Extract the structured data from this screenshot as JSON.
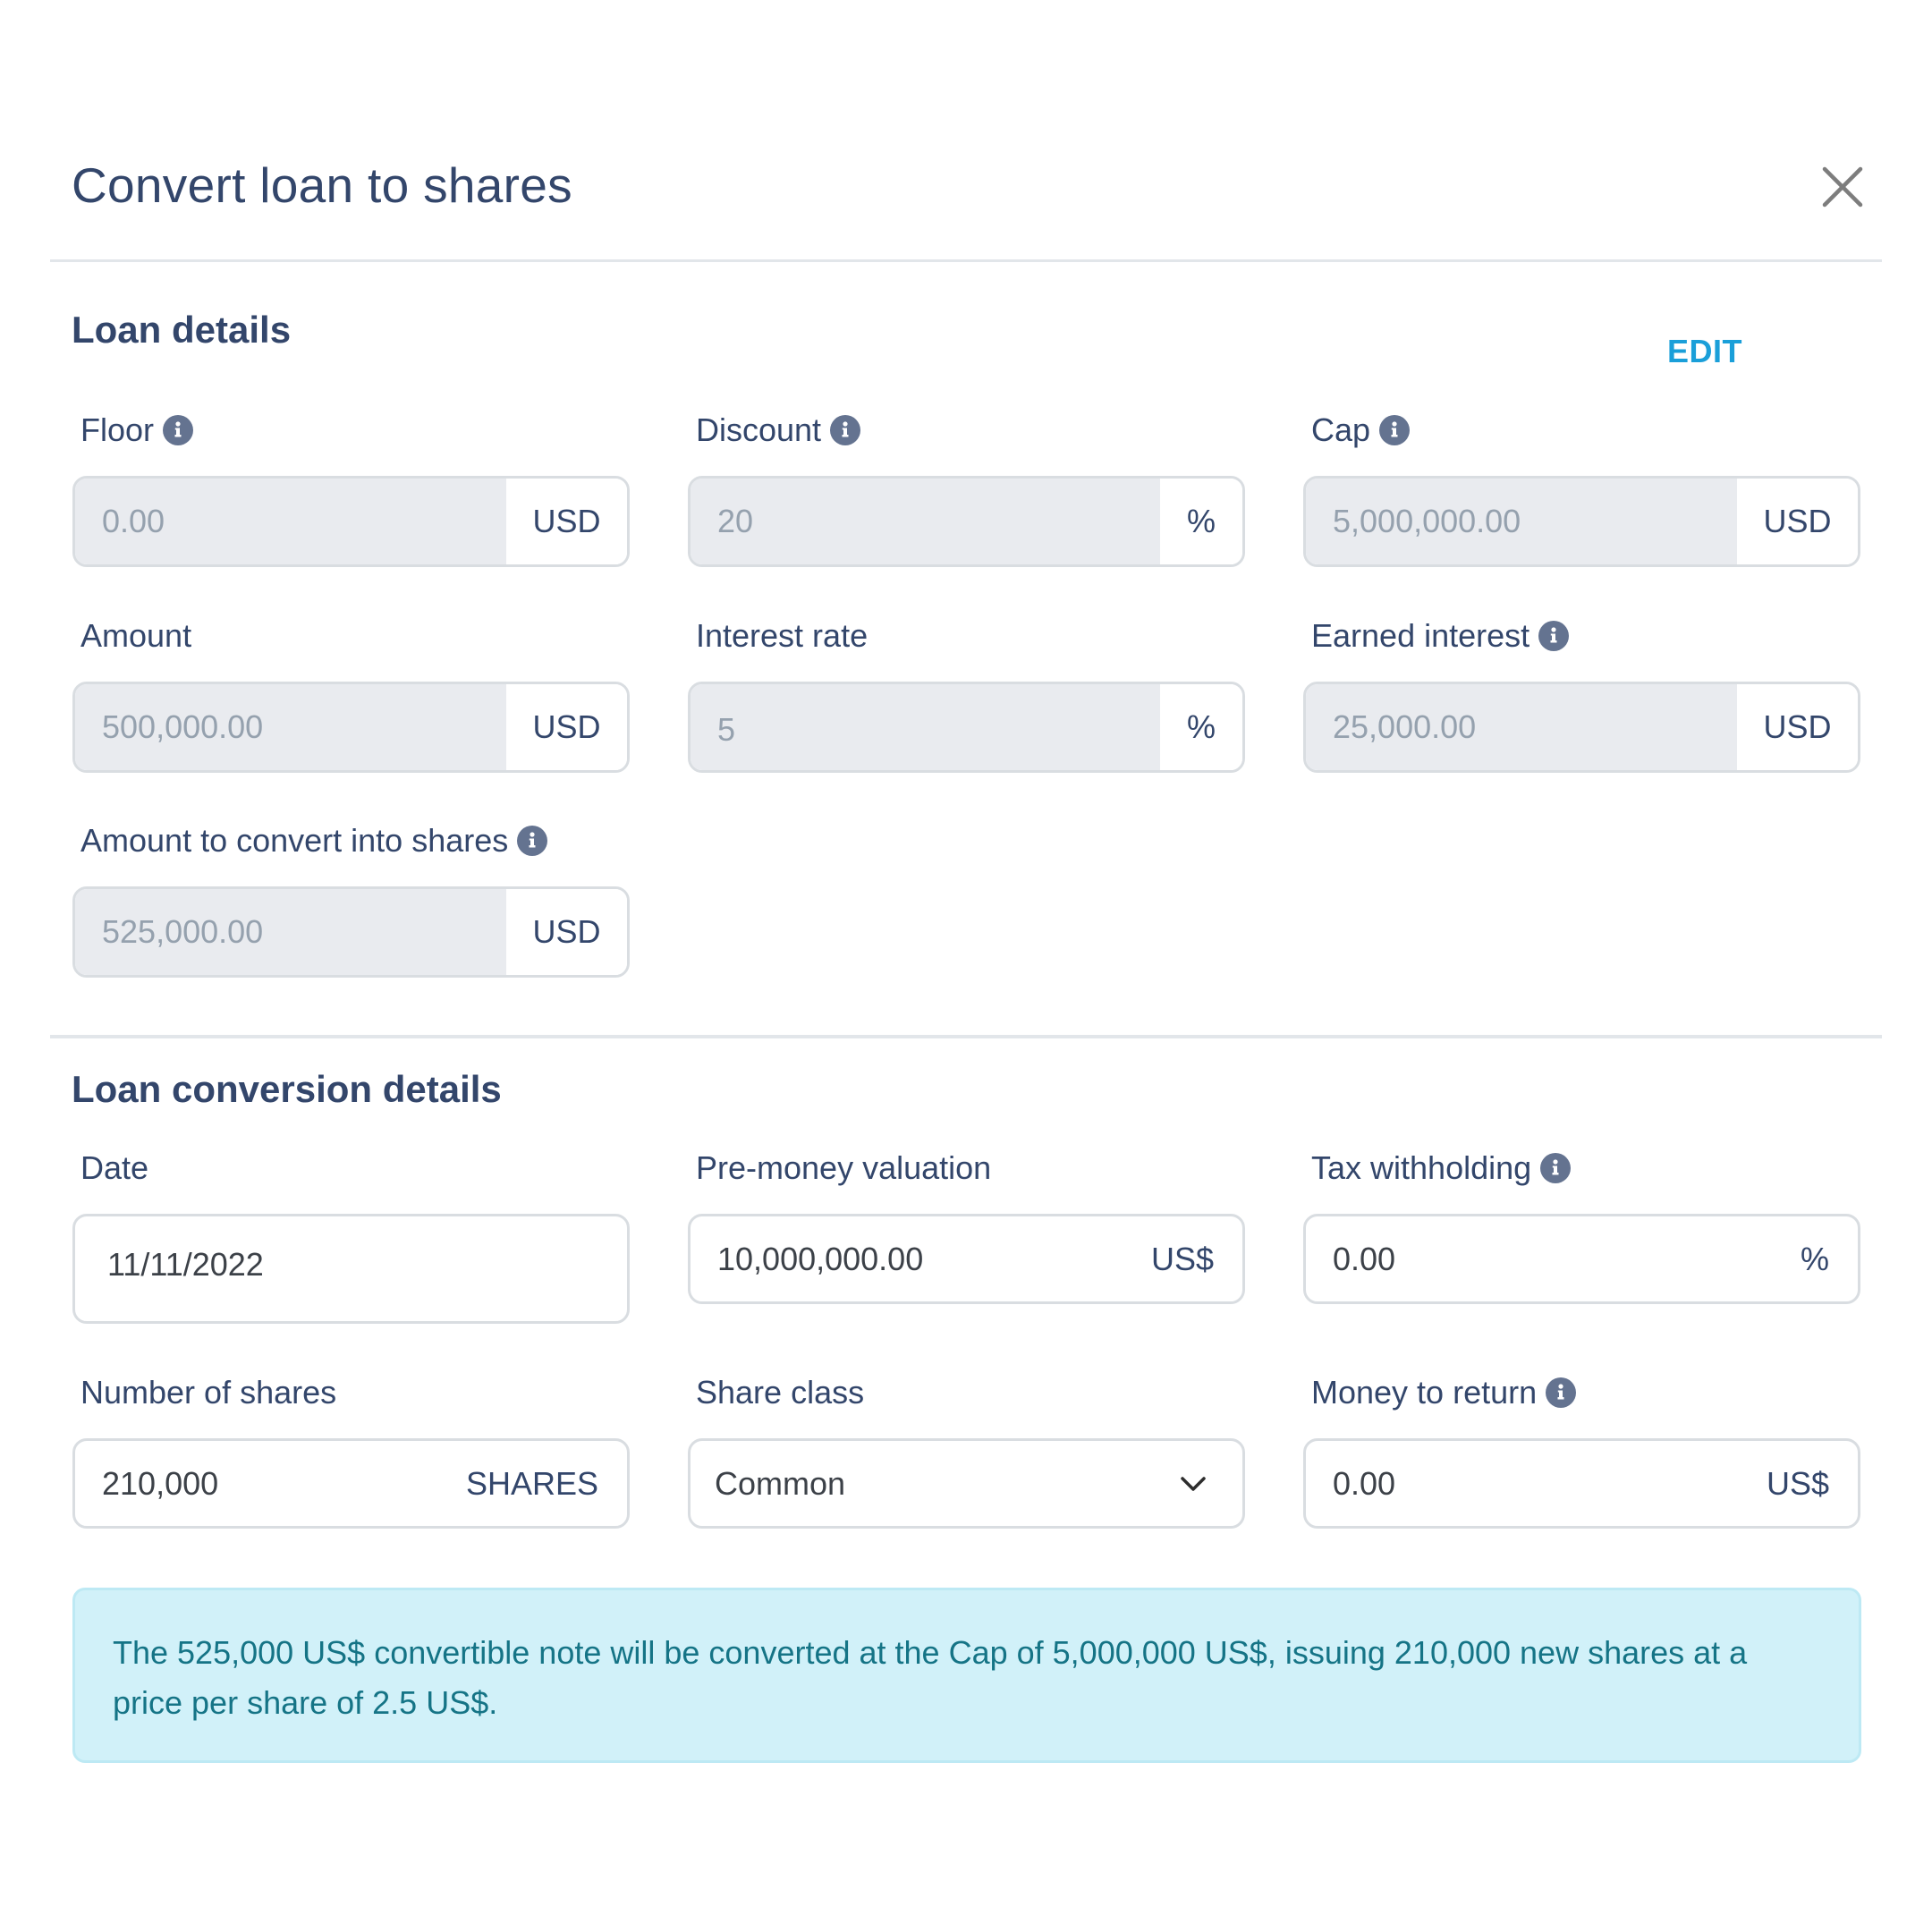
{
  "dialog": {
    "title": "Convert loan to shares",
    "close_icon": "close-icon"
  },
  "loan_details": {
    "heading": "Loan details",
    "edit_label": "EDIT",
    "fields": {
      "floor": {
        "label": "Floor",
        "value": "0.00",
        "unit": "USD",
        "info_icon": true
      },
      "discount": {
        "label": "Discount",
        "value": "20",
        "unit": "%",
        "info_icon": true
      },
      "cap": {
        "label": "Cap",
        "value": "5,000,000.00",
        "unit": "USD",
        "info_icon": true
      },
      "amount": {
        "label": "Amount",
        "value": "500,000.00",
        "unit": "USD",
        "info_icon": false
      },
      "interest_rate": {
        "label": "Interest rate",
        "value": "5",
        "unit": "%",
        "info_icon": false
      },
      "earned_interest": {
        "label": "Earned interest",
        "value": "25,000.00",
        "unit": "USD",
        "info_icon": true
      },
      "amount_to_convert": {
        "label": "Amount to convert into shares",
        "value": "525,000.00",
        "unit": "USD",
        "info_icon": true
      }
    }
  },
  "conversion_details": {
    "heading": "Loan conversion details",
    "fields": {
      "date": {
        "label": "Date",
        "value": "11/11/2022"
      },
      "pre_money_valuation": {
        "label": "Pre-money valuation",
        "value": "10,000,000.00",
        "unit": "US$"
      },
      "tax_withholding": {
        "label": "Tax withholding",
        "value": "0.00",
        "unit": "%",
        "info_icon": true
      },
      "number_of_shares": {
        "label": "Number of shares",
        "value": "210,000",
        "unit": "SHARES"
      },
      "share_class": {
        "label": "Share class",
        "selected": "Common"
      },
      "money_to_return": {
        "label": "Money to return",
        "value": "0.00",
        "unit": "US$",
        "info_icon": true
      }
    }
  },
  "alert": {
    "message": "The 525,000 US$ convertible note will be converted at the Cap of 5,000,000 US$, issuing 210,000 new shares at a price per share of 2.5 US$."
  },
  "colors": {
    "primary_text": "#33466b",
    "accent": "#1a9fd9",
    "disabled_bg": "#e9ebef",
    "alert_bg": "#d1f1f9",
    "alert_text": "#157486"
  }
}
